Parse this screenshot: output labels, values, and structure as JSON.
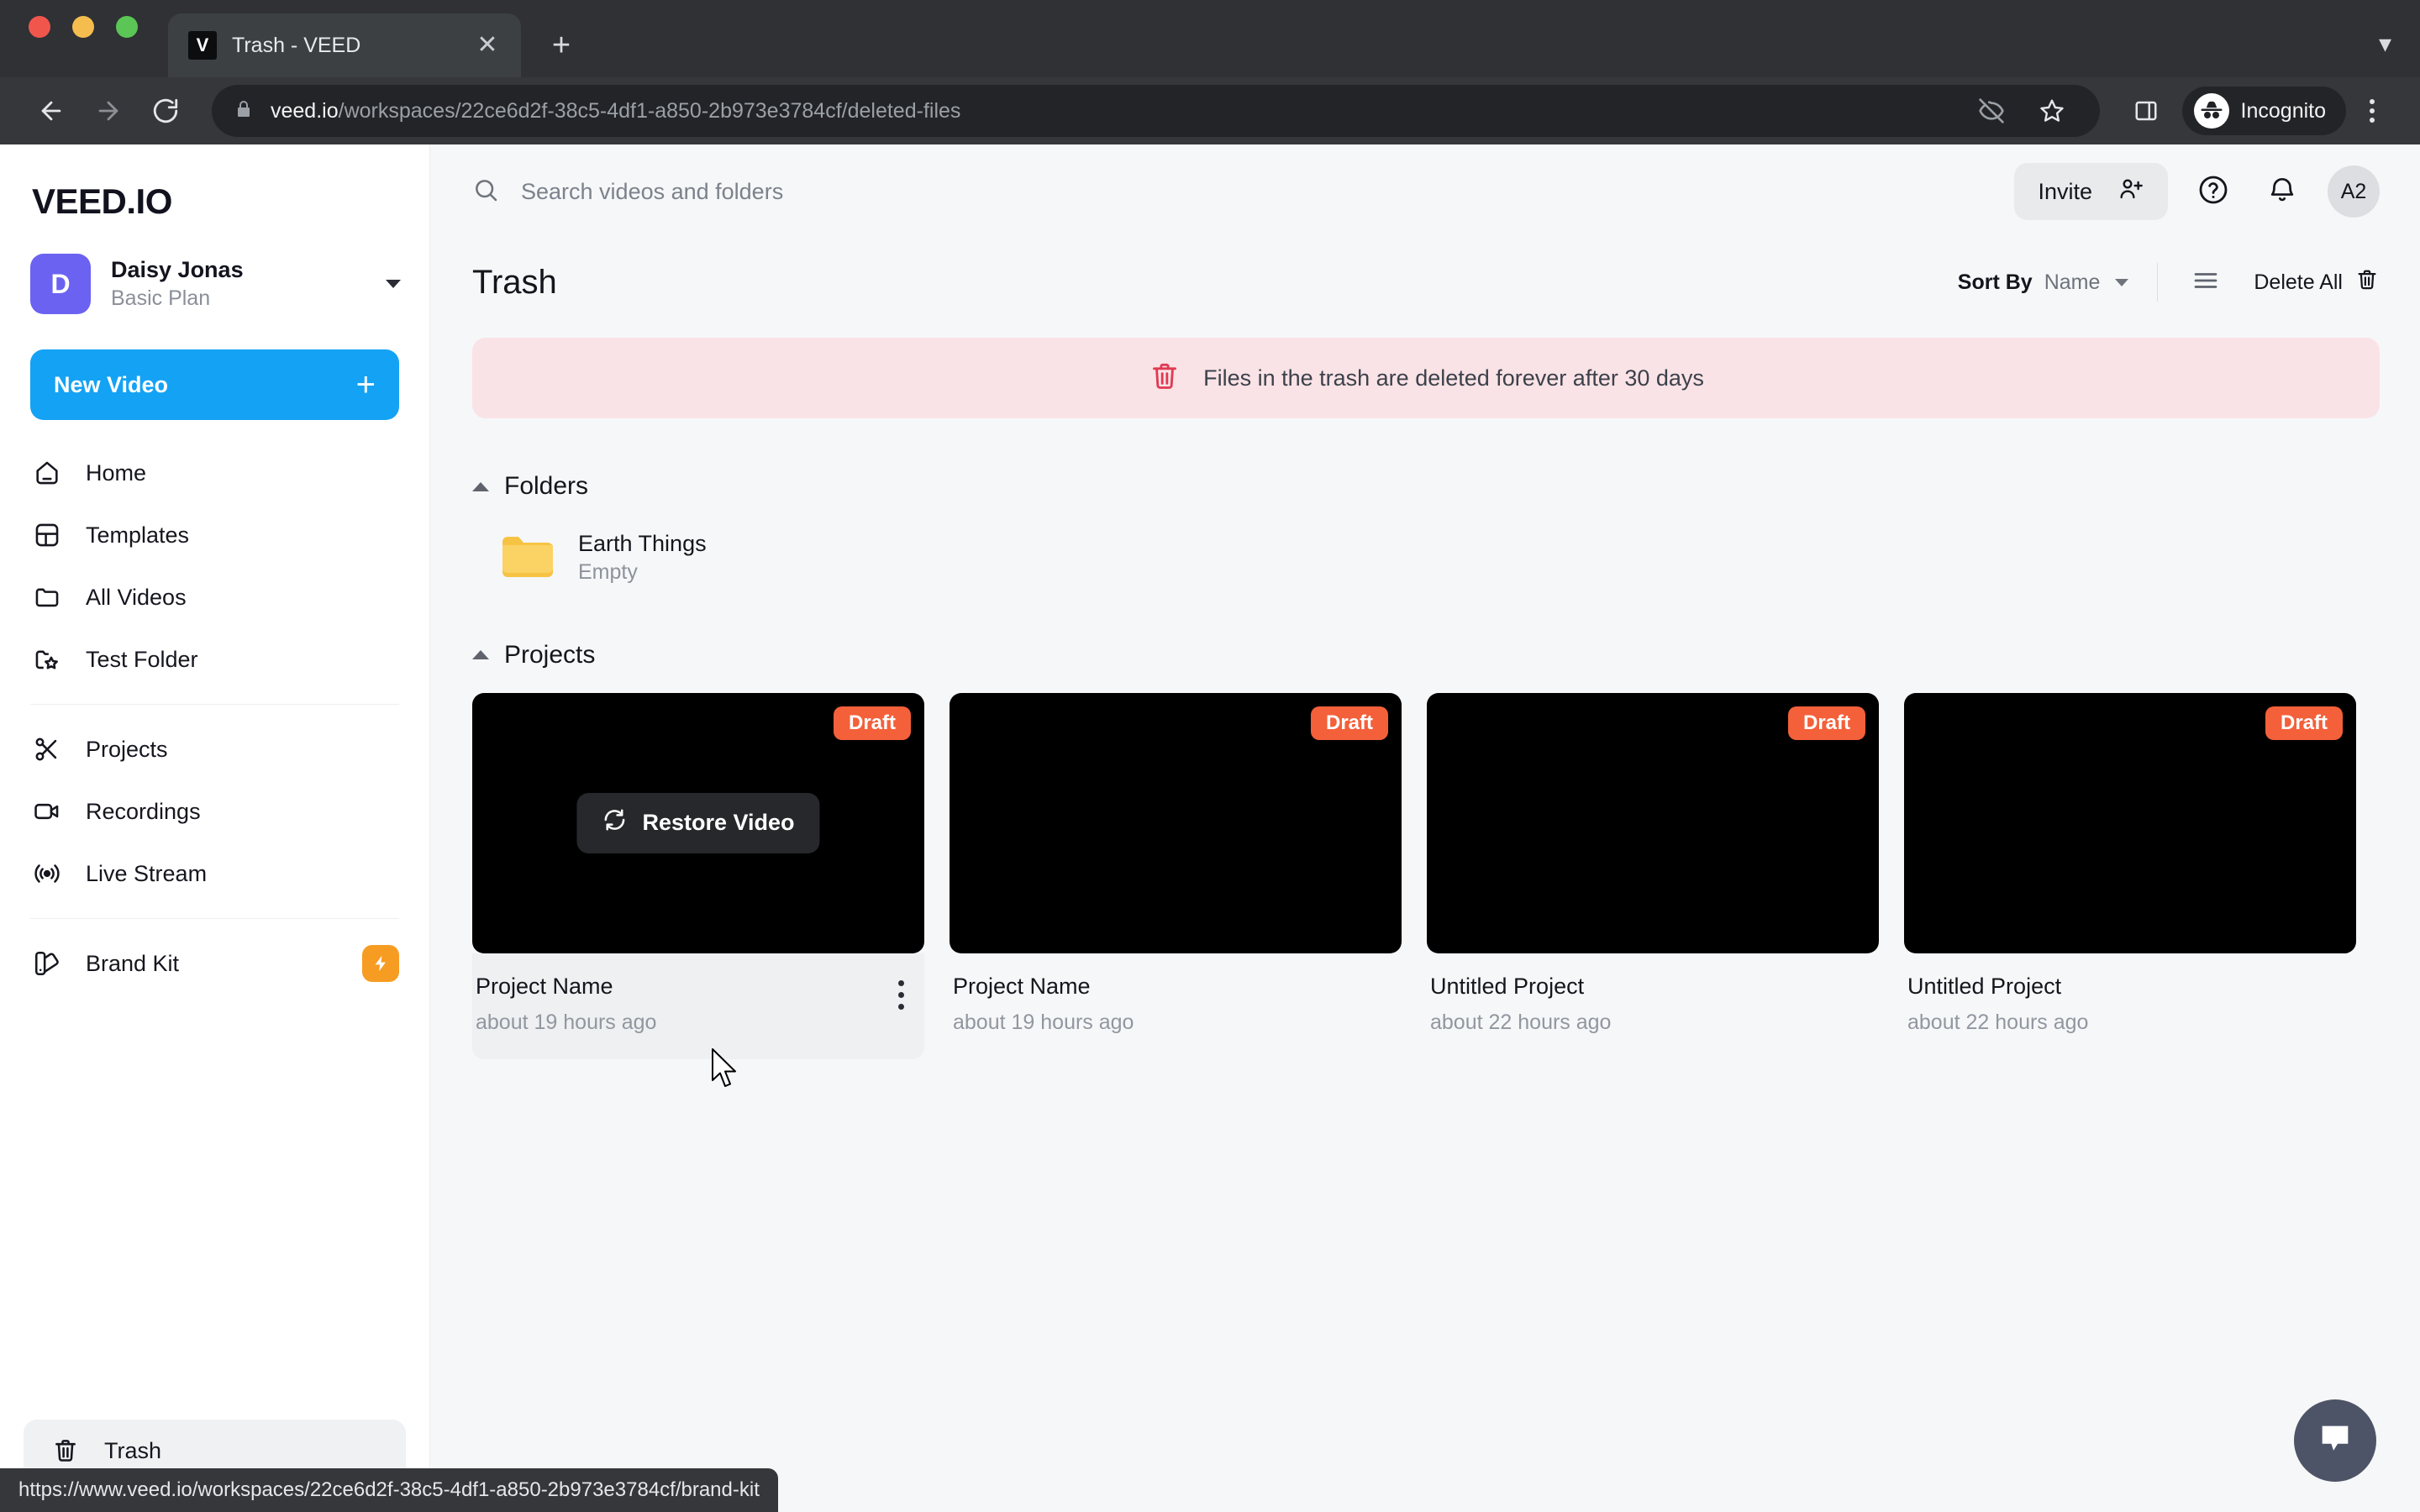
{
  "browser": {
    "tab": {
      "title": "Trash - VEED",
      "favicon_letter": "V",
      "close_icon": "close-icon",
      "new_tab_icon": "plus-icon"
    },
    "url": {
      "host": "veed.io",
      "path": "/workspaces/22ce6d2f-38c5-4df1-a850-2b973e3784cf/deleted-files"
    },
    "profile_label": "Incognito",
    "status_url": "https://www.veed.io/workspaces/22ce6d2f-38c5-4df1-a850-2b973e3784cf/brand-kit"
  },
  "sidebar": {
    "brand": "VEED.IO",
    "profile": {
      "initial": "D",
      "name": "Daisy Jonas",
      "plan": "Basic Plan"
    },
    "new_video": {
      "label": "New Video",
      "plus": "+"
    },
    "items": [
      {
        "label": "Home",
        "icon": "home-icon"
      },
      {
        "label": "Templates",
        "icon": "layout-icon"
      },
      {
        "label": "All Videos",
        "icon": "folder-icon"
      },
      {
        "label": "Test Folder",
        "icon": "folder-star-icon"
      },
      {
        "label": "Projects",
        "icon": "scissors-icon"
      },
      {
        "label": "Recordings",
        "icon": "video-camera-icon"
      },
      {
        "label": "Live Stream",
        "icon": "broadcast-icon"
      },
      {
        "label": "Brand Kit",
        "icon": "brand-kit-icon",
        "badge": "bolt-icon"
      }
    ],
    "trash": {
      "label": "Trash",
      "icon": "trash-icon"
    }
  },
  "topbar": {
    "search_placeholder": "Search videos and folders",
    "invite_label": "Invite",
    "help_icon": "question-circle-icon",
    "bell_icon": "bell-icon",
    "avatar_label": "A2"
  },
  "page": {
    "title": "Trash",
    "sort_by_label": "Sort By",
    "sort_by_value": "Name",
    "list_view_icon": "list-view-icon",
    "delete_all_label": "Delete All",
    "delete_all_icon": "trash-icon",
    "banner": {
      "icon": "trash-icon",
      "text": "Files in the trash are deleted forever after 30 days"
    }
  },
  "folders_section": {
    "title": "Folders",
    "items": [
      {
        "name": "Earth Things",
        "sub": "Empty",
        "icon": "folder-icon"
      }
    ]
  },
  "projects_section": {
    "title": "Projects",
    "restore_label": "Restore Video",
    "restore_icon": "refresh-icon",
    "items": [
      {
        "name": "Project Name",
        "date": "about 19 hours ago",
        "badge": "Draft",
        "hovered": true
      },
      {
        "name": "Project Name",
        "date": "about 19 hours ago",
        "badge": "Draft",
        "hovered": false
      },
      {
        "name": "Untitled Project",
        "date": "about 22 hours ago",
        "badge": "Draft",
        "hovered": false
      },
      {
        "name": "Untitled Project",
        "date": "about 22 hours ago",
        "badge": "Draft",
        "hovered": false
      }
    ]
  },
  "chat": {
    "icon": "chat-bubble-icon"
  },
  "colors": {
    "accent_blue": "#14a2f4",
    "avatar_purple": "#6b62f2",
    "draft_orange": "#f4603a",
    "badge_orange": "#f79c22",
    "banner_pink": "#fae3e6",
    "banner_icon_red": "#e03a52"
  }
}
